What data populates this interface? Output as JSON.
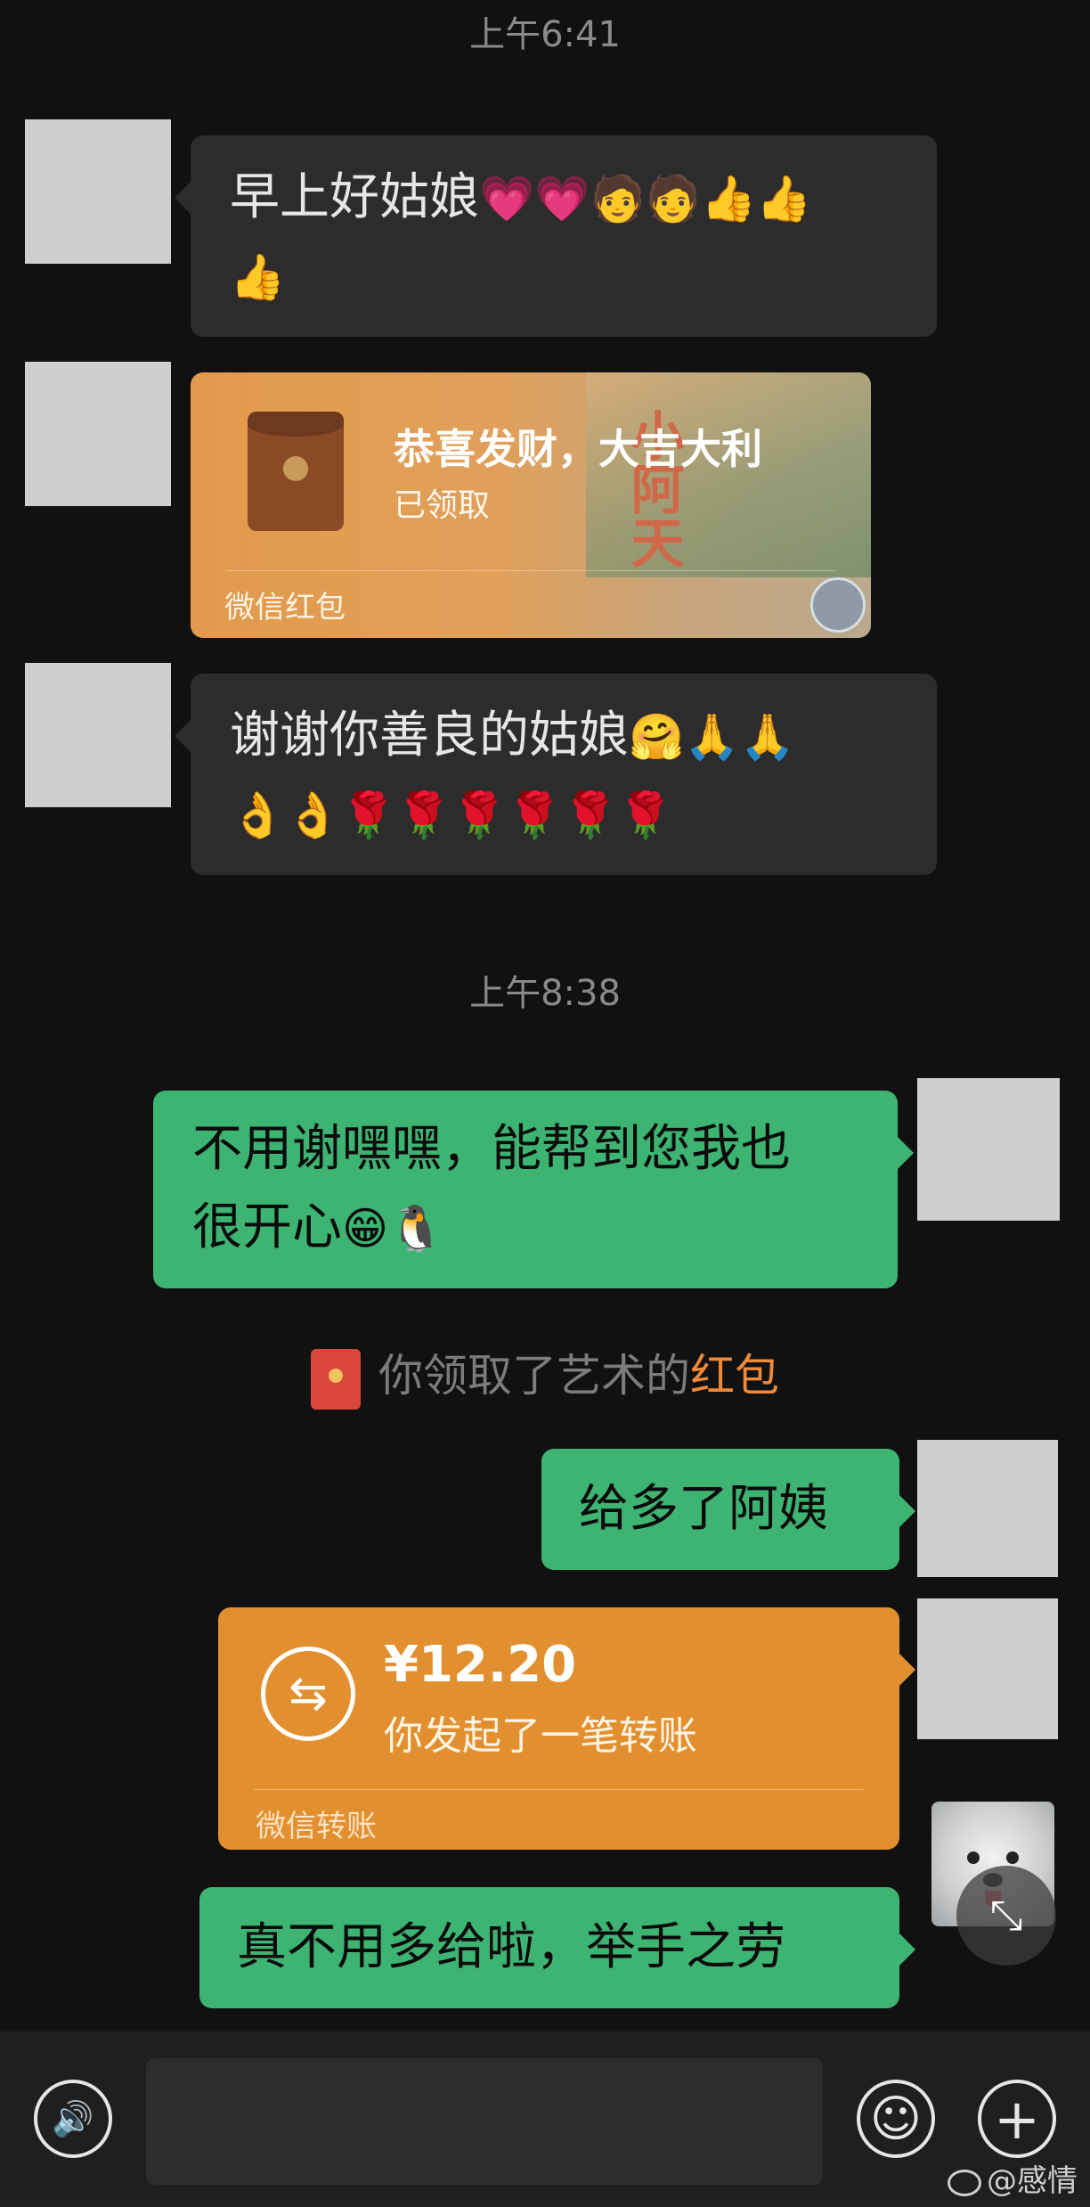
{
  "timestamps": {
    "first": "上午6:41",
    "second": "上午8:38"
  },
  "messages": {
    "m1": {
      "text": "早上好姑娘",
      "emojis_line1": "💗💗🧑🧑👍👍",
      "emojis_line2": "👍"
    },
    "m2_redpacket": {
      "title": "恭喜发财，大吉大利",
      "status": "已领取",
      "label": "微信红包",
      "art_text": "小阿天"
    },
    "m3": {
      "text": "谢谢你善良的姑娘",
      "emojis_line1": "🤗🙏🙏",
      "emojis_line2": "👌👌🌹🌹🌹🌹🌹🌹"
    },
    "m4": {
      "line1": "不用谢嘿嘿，能帮到您我也",
      "line2": "很开心",
      "emojis": "😁🐧"
    },
    "notice": {
      "prefix": "你领取了艺术的",
      "highlight": "红包"
    },
    "m5": {
      "text": "给多了阿姨"
    },
    "m6_transfer": {
      "amount": "¥12.20",
      "desc": "你发起了一笔转账",
      "label": "微信转账",
      "icon": "⇆"
    },
    "m7": {
      "text": "真不用多给啦，举手之劳"
    }
  },
  "icons": {
    "voice": "🔊",
    "emoji": "☺",
    "plus": "+",
    "collapse": "⤡"
  },
  "input": {
    "value": "",
    "placeholder": ""
  },
  "watermark": {
    "text": "@感情"
  },
  "colors": {
    "outgoing_bubble": "#3eb472",
    "incoming_bubble": "#2c2c2c",
    "transfer": "#e2902f",
    "highlight": "#f08a3a"
  }
}
